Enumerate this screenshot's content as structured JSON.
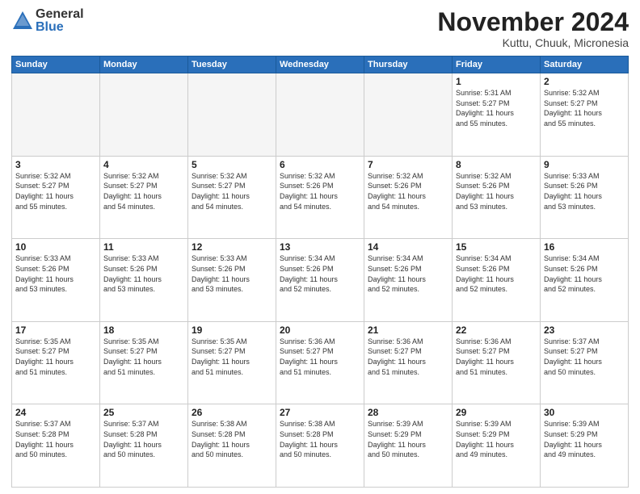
{
  "logo": {
    "general": "General",
    "blue": "Blue"
  },
  "header": {
    "month": "November 2024",
    "location": "Kuttu, Chuuk, Micronesia"
  },
  "weekdays": [
    "Sunday",
    "Monday",
    "Tuesday",
    "Wednesday",
    "Thursday",
    "Friday",
    "Saturday"
  ],
  "weeks": [
    [
      {
        "day": "",
        "info": ""
      },
      {
        "day": "",
        "info": ""
      },
      {
        "day": "",
        "info": ""
      },
      {
        "day": "",
        "info": ""
      },
      {
        "day": "",
        "info": ""
      },
      {
        "day": "1",
        "info": "Sunrise: 5:31 AM\nSunset: 5:27 PM\nDaylight: 11 hours\nand 55 minutes."
      },
      {
        "day": "2",
        "info": "Sunrise: 5:32 AM\nSunset: 5:27 PM\nDaylight: 11 hours\nand 55 minutes."
      }
    ],
    [
      {
        "day": "3",
        "info": "Sunrise: 5:32 AM\nSunset: 5:27 PM\nDaylight: 11 hours\nand 55 minutes."
      },
      {
        "day": "4",
        "info": "Sunrise: 5:32 AM\nSunset: 5:27 PM\nDaylight: 11 hours\nand 54 minutes."
      },
      {
        "day": "5",
        "info": "Sunrise: 5:32 AM\nSunset: 5:27 PM\nDaylight: 11 hours\nand 54 minutes."
      },
      {
        "day": "6",
        "info": "Sunrise: 5:32 AM\nSunset: 5:26 PM\nDaylight: 11 hours\nand 54 minutes."
      },
      {
        "day": "7",
        "info": "Sunrise: 5:32 AM\nSunset: 5:26 PM\nDaylight: 11 hours\nand 54 minutes."
      },
      {
        "day": "8",
        "info": "Sunrise: 5:32 AM\nSunset: 5:26 PM\nDaylight: 11 hours\nand 53 minutes."
      },
      {
        "day": "9",
        "info": "Sunrise: 5:33 AM\nSunset: 5:26 PM\nDaylight: 11 hours\nand 53 minutes."
      }
    ],
    [
      {
        "day": "10",
        "info": "Sunrise: 5:33 AM\nSunset: 5:26 PM\nDaylight: 11 hours\nand 53 minutes."
      },
      {
        "day": "11",
        "info": "Sunrise: 5:33 AM\nSunset: 5:26 PM\nDaylight: 11 hours\nand 53 minutes."
      },
      {
        "day": "12",
        "info": "Sunrise: 5:33 AM\nSunset: 5:26 PM\nDaylight: 11 hours\nand 53 minutes."
      },
      {
        "day": "13",
        "info": "Sunrise: 5:34 AM\nSunset: 5:26 PM\nDaylight: 11 hours\nand 52 minutes."
      },
      {
        "day": "14",
        "info": "Sunrise: 5:34 AM\nSunset: 5:26 PM\nDaylight: 11 hours\nand 52 minutes."
      },
      {
        "day": "15",
        "info": "Sunrise: 5:34 AM\nSunset: 5:26 PM\nDaylight: 11 hours\nand 52 minutes."
      },
      {
        "day": "16",
        "info": "Sunrise: 5:34 AM\nSunset: 5:26 PM\nDaylight: 11 hours\nand 52 minutes."
      }
    ],
    [
      {
        "day": "17",
        "info": "Sunrise: 5:35 AM\nSunset: 5:27 PM\nDaylight: 11 hours\nand 51 minutes."
      },
      {
        "day": "18",
        "info": "Sunrise: 5:35 AM\nSunset: 5:27 PM\nDaylight: 11 hours\nand 51 minutes."
      },
      {
        "day": "19",
        "info": "Sunrise: 5:35 AM\nSunset: 5:27 PM\nDaylight: 11 hours\nand 51 minutes."
      },
      {
        "day": "20",
        "info": "Sunrise: 5:36 AM\nSunset: 5:27 PM\nDaylight: 11 hours\nand 51 minutes."
      },
      {
        "day": "21",
        "info": "Sunrise: 5:36 AM\nSunset: 5:27 PM\nDaylight: 11 hours\nand 51 minutes."
      },
      {
        "day": "22",
        "info": "Sunrise: 5:36 AM\nSunset: 5:27 PM\nDaylight: 11 hours\nand 51 minutes."
      },
      {
        "day": "23",
        "info": "Sunrise: 5:37 AM\nSunset: 5:27 PM\nDaylight: 11 hours\nand 50 minutes."
      }
    ],
    [
      {
        "day": "24",
        "info": "Sunrise: 5:37 AM\nSunset: 5:28 PM\nDaylight: 11 hours\nand 50 minutes."
      },
      {
        "day": "25",
        "info": "Sunrise: 5:37 AM\nSunset: 5:28 PM\nDaylight: 11 hours\nand 50 minutes."
      },
      {
        "day": "26",
        "info": "Sunrise: 5:38 AM\nSunset: 5:28 PM\nDaylight: 11 hours\nand 50 minutes."
      },
      {
        "day": "27",
        "info": "Sunrise: 5:38 AM\nSunset: 5:28 PM\nDaylight: 11 hours\nand 50 minutes."
      },
      {
        "day": "28",
        "info": "Sunrise: 5:39 AM\nSunset: 5:29 PM\nDaylight: 11 hours\nand 50 minutes."
      },
      {
        "day": "29",
        "info": "Sunrise: 5:39 AM\nSunset: 5:29 PM\nDaylight: 11 hours\nand 49 minutes."
      },
      {
        "day": "30",
        "info": "Sunrise: 5:39 AM\nSunset: 5:29 PM\nDaylight: 11 hours\nand 49 minutes."
      }
    ]
  ]
}
